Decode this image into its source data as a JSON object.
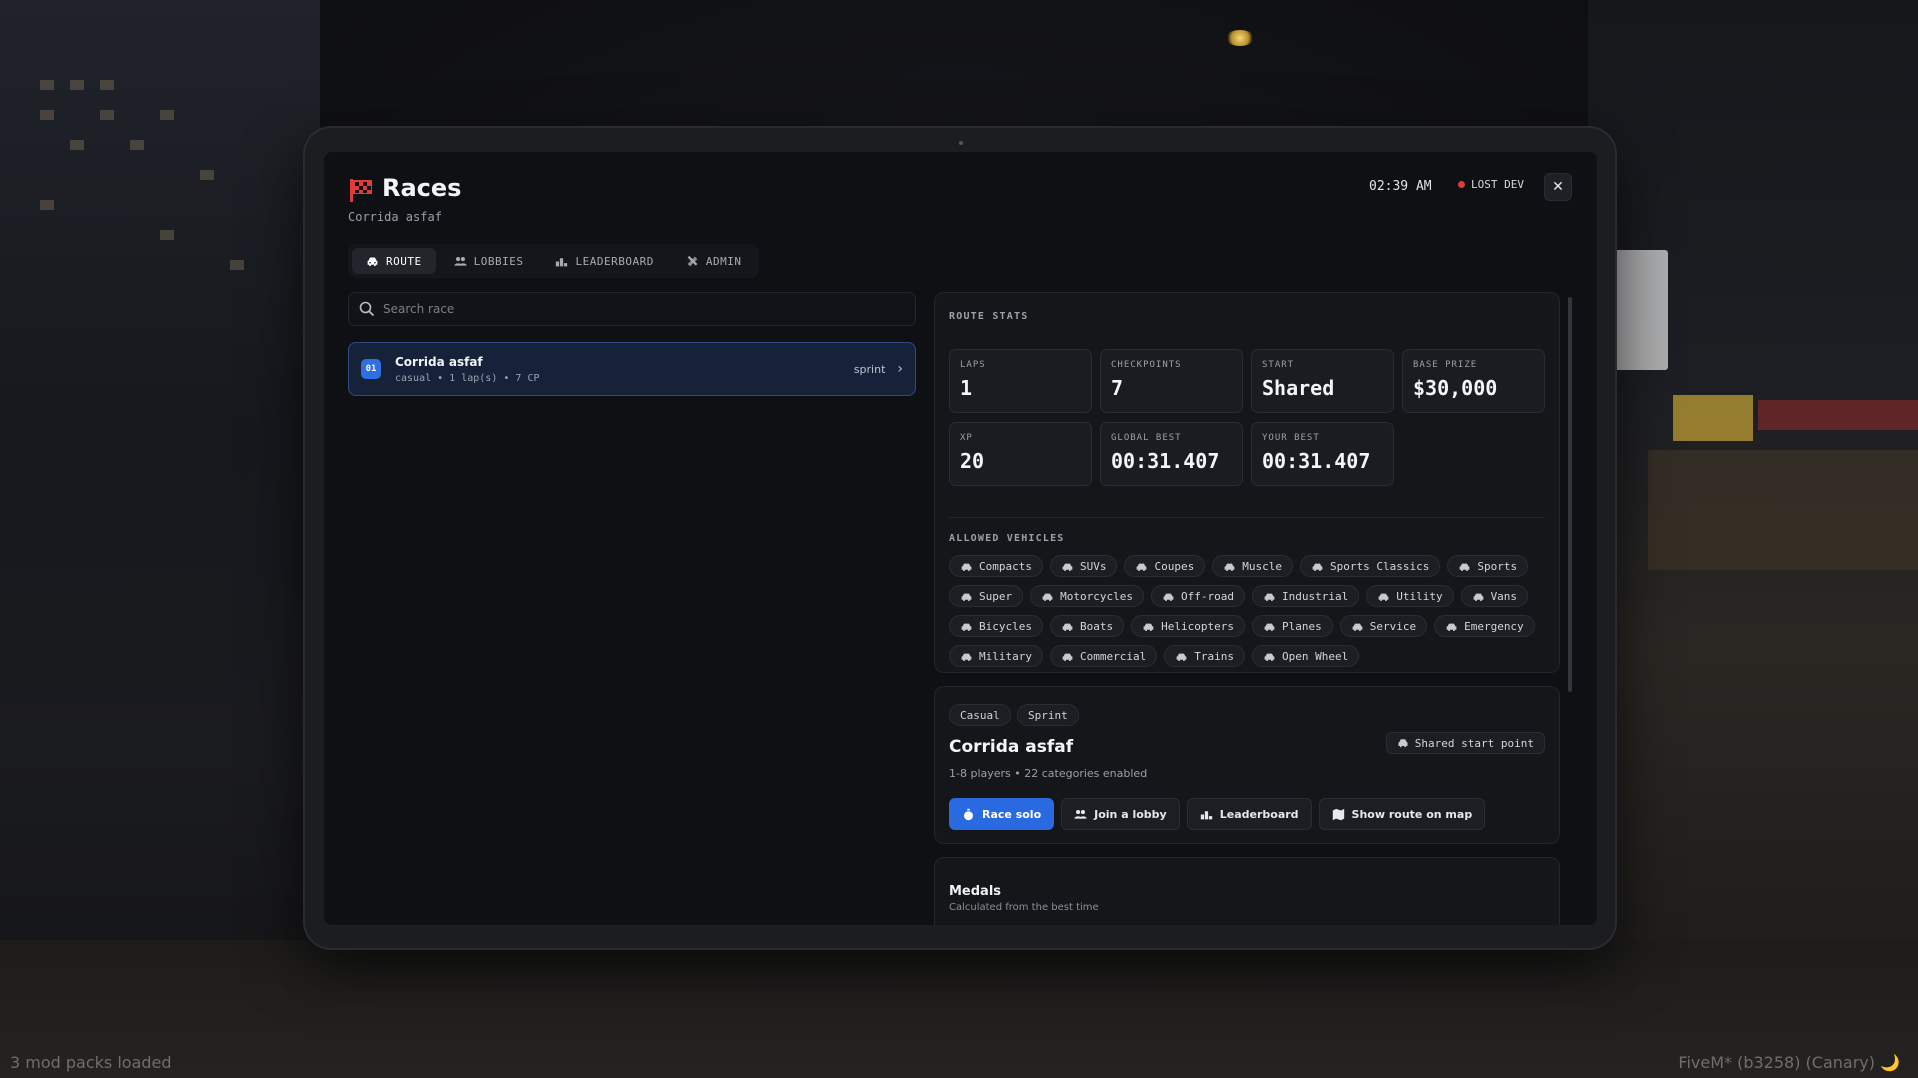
{
  "header": {
    "title": "Races",
    "subtitle": "Corrida asfaf",
    "time": "02:39 AM",
    "status": "LOST DEV",
    "close": "✕"
  },
  "tabs": [
    {
      "label": "ROUTE",
      "icon": "car-icon",
      "active": true
    },
    {
      "label": "LOBBIES",
      "icon": "users-icon",
      "active": false
    },
    {
      "label": "LEADERBOARD",
      "icon": "podium-icon",
      "active": false
    },
    {
      "label": "ADMIN",
      "icon": "tools-icon",
      "active": false
    }
  ],
  "search": {
    "placeholder": "Search race",
    "value": ""
  },
  "race_list": [
    {
      "number": "01",
      "name": "Corrida asfaf",
      "meta": "casual • 1 lap(s) • 7 CP",
      "type": "sprint"
    }
  ],
  "route_stats": {
    "title": "ROUTE STATS",
    "stats": [
      {
        "label": "LAPS",
        "value": "1"
      },
      {
        "label": "CHECKPOINTS",
        "value": "7"
      },
      {
        "label": "START",
        "value": "Shared"
      },
      {
        "label": "BASE PRIZE",
        "value": "$30,000"
      },
      {
        "label": "XP",
        "value": "20"
      },
      {
        "label": "GLOBAL BEST",
        "value": "00:31.407"
      },
      {
        "label": "YOUR BEST",
        "value": "00:31.407"
      }
    ],
    "vehicles_title": "ALLOWED VEHICLES",
    "vehicles": [
      "Compacts",
      "SUVs",
      "Coupes",
      "Muscle",
      "Sports Classics",
      "Sports",
      "Super",
      "Motorcycles",
      "Off-road",
      "Industrial",
      "Utility",
      "Vans",
      "Bicycles",
      "Boats",
      "Helicopters",
      "Planes",
      "Service",
      "Emergency",
      "Military",
      "Commercial",
      "Trains",
      "Open Wheel"
    ]
  },
  "race_detail": {
    "tags": [
      "Casual",
      "Sprint"
    ],
    "name": "Corrida asfaf",
    "info": "1-8 players • 22 categories enabled",
    "shared_start": "Shared start point",
    "actions": [
      {
        "label": "Race solo",
        "icon": "stopwatch-icon",
        "primary": true
      },
      {
        "label": "Join a lobby",
        "icon": "users-icon",
        "primary": false
      },
      {
        "label": "Leaderboard",
        "icon": "podium-icon",
        "primary": false
      },
      {
        "label": "Show route on map",
        "icon": "map-icon",
        "primary": false
      }
    ]
  },
  "medals": {
    "title": "Medals",
    "subtitle": "Calculated from the best time"
  },
  "footer": {
    "left": "3 mod packs loaded",
    "right": "FiveM* (b3258) (Canary) 🌙"
  },
  "colors": {
    "accent": "#2a6ae0",
    "flag_red": "#e23a3a",
    "panel_bg": "#15161a"
  }
}
